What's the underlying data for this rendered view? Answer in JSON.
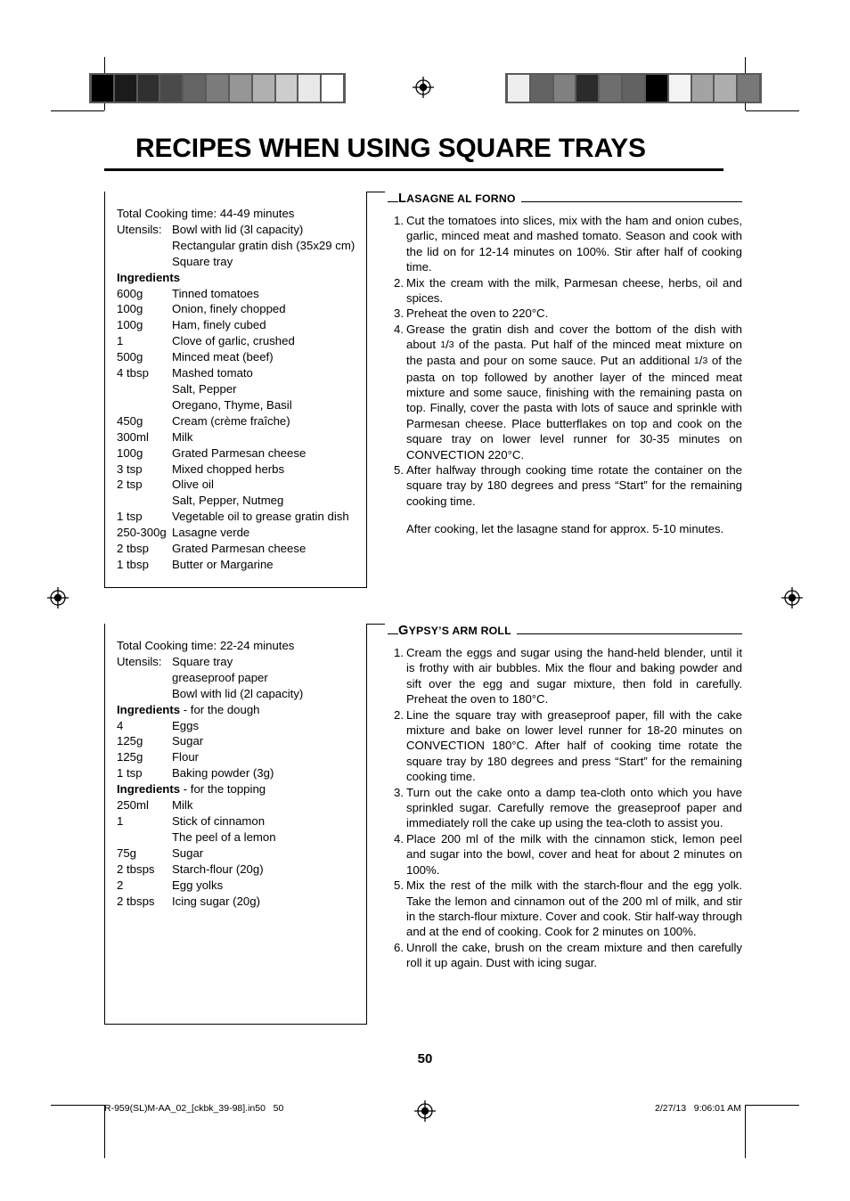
{
  "page": {
    "title": "RECIPES WHEN USING SQUARE TRAYS",
    "page_number": "50"
  },
  "printbar": {
    "left_wedge_name": "grayscale-step-wedge-left",
    "right_wedge_name": "grayscale-step-wedge-right",
    "left_patches": [
      "#000000",
      "#1b1b1b",
      "#303030",
      "#4a4a4a",
      "#646464",
      "#7b7b7b",
      "#969696",
      "#b0b0b0",
      "#cdcdcd",
      "#e8e8e8",
      "#ffffff"
    ],
    "right_patches": [
      "#eeeeee",
      "#636363",
      "#808080",
      "#2b2b2b",
      "#6e6e6e",
      "#626262",
      "#000000",
      "#f3f3f3",
      "#a3a3a3",
      "#aeaeae",
      "#787878"
    ]
  },
  "recipes": [
    {
      "heading_first": "L",
      "heading_rest": "ASAGNE AL FORNO",
      "cooking_time_label": "Total Cooking time:",
      "cooking_time_value": "44-49 minutes",
      "utensils_label": "Utensils:",
      "utensils": [
        "Bowl with lid (3l capacity)",
        "Rectangular gratin dish (35x29 cm)",
        "Square tray"
      ],
      "ingredients_label": "Ingredients",
      "ingredients_suffix": "",
      "ingredients": [
        {
          "qty": "600g",
          "name": "Tinned tomatoes"
        },
        {
          "qty": "100g",
          "name": "Onion, finely chopped"
        },
        {
          "qty": "100g",
          "name": "Ham, finely cubed"
        },
        {
          "qty": "1",
          "name": "Clove of garlic, crushed"
        },
        {
          "qty": "500g",
          "name": "Minced meat (beef)"
        },
        {
          "qty": "4 tbsp",
          "name": "Mashed tomato"
        },
        {
          "qty": "",
          "name": "Salt, Pepper"
        },
        {
          "qty": "",
          "name": "Oregano, Thyme, Basil"
        },
        {
          "qty": "450g",
          "name": "Cream (crème fraîche)"
        },
        {
          "qty": "300ml",
          "name": "Milk"
        },
        {
          "qty": "100g",
          "name": "Grated Parmesan cheese"
        },
        {
          "qty": "3 tsp",
          "name": "Mixed chopped herbs"
        },
        {
          "qty": "2 tsp",
          "name": "Olive oil"
        },
        {
          "qty": "",
          "name": "Salt, Pepper, Nutmeg"
        },
        {
          "qty": "1 tsp",
          "name": "Vegetable oil to grease gratin dish"
        },
        {
          "qty": "250-300g",
          "name": "Lasagne verde"
        },
        {
          "qty": "2 tbsp",
          "name": "Grated Parmesan cheese"
        },
        {
          "qty": "1 tbsp",
          "name": "Butter or Margarine"
        }
      ],
      "steps": [
        "Cut the tomatoes into slices, mix with the ham and onion cubes, garlic, minced meat and mashed tomato. Season and cook with the lid on for 12-14 minutes on 100%. Stir after half of cooking time.",
        "Mix the cream with the milk, Parmesan cheese, herbs, oil and spices.",
        "Preheat the oven to 220°C.",
        "Grease the gratin dish and cover the bottom of the dish with about <sup>1</sup>/<sub>3</sub> of the pasta. Put half of the minced meat mixture on the pasta and pour on some sauce. Put an additional <sup>1</sup>/<sub>3</sub> of the pasta on top followed by another layer of the minced meat mixture and some sauce, finishing with the remaining pasta on top. Finally, cover the pasta with lots of sauce and sprinkle with Parmesan cheese. Place butterflakes on top and cook on the square tray on lower level runner for 30-35 minutes on CONVECTION 220°C.",
        "After halfway through cooking time rotate the container on the square tray by 180 degrees and press “Start” for the remaining cooking time."
      ],
      "after_note": "After cooking, let the lasagne stand for approx. 5-10 minutes."
    },
    {
      "heading_first": "G",
      "heading_rest": "YPSY’S ARM ROLL",
      "cooking_time_label": "Total Cooking time:",
      "cooking_time_value": "22-24 minutes",
      "utensils_label": "Utensils:",
      "utensils": [
        "Square tray",
        "greaseproof paper",
        "Bowl with lid (2l capacity)"
      ],
      "ingredients_label": "Ingredients",
      "ingredients_suffix": " - for the dough",
      "ingredients": [
        {
          "qty": "4",
          "name": "Eggs"
        },
        {
          "qty": "125g",
          "name": "Sugar"
        },
        {
          "qty": "125g",
          "name": "Flour"
        },
        {
          "qty": "1 tsp",
          "name": "Baking powder (3g)"
        }
      ],
      "ingredients_label2": "Ingredients",
      "ingredients_suffix2": " - for the topping",
      "ingredients2": [
        {
          "qty": "250ml",
          "name": "Milk"
        },
        {
          "qty": "1",
          "name": "Stick of cinnamon"
        },
        {
          "qty": "",
          "name": "The peel of a lemon"
        },
        {
          "qty": "75g",
          "name": "Sugar"
        },
        {
          "qty": "2 tbsps",
          "name": "Starch-flour (20g)"
        },
        {
          "qty": "2",
          "name": "Egg yolks"
        },
        {
          "qty": "2 tbsps",
          "name": "Icing sugar (20g)"
        }
      ],
      "steps": [
        "Cream the eggs and sugar using the hand-held blender, until it is frothy with air bubbles. Mix the flour and baking powder and sift over the egg and sugar mixture, then fold in carefully. Preheat the oven to 180°C.",
        "Line the square tray with greaseproof paper, fill with the cake mixture and bake on lower level runner for 18-20 minutes on CONVECTION 180°C. After half of cooking time rotate the square tray by 180 degrees and press “Start” for the remaining cooking time.",
        "Turn out the cake onto a damp tea-cloth onto which you have sprinkled sugar. Carefully remove the greaseproof paper and immediately roll the cake up using the tea-cloth to assist you.",
        "Place 200 ml of the milk with the cinnamon stick, lemon peel and sugar into the bowl, cover and heat for about 2 minutes on 100%.",
        "Mix the rest of the milk with the starch-flour and the egg yolk. Take the lemon and cinnamon out of the 200 ml of milk, and stir in the starch-flour mixture. Cover and cook. Stir half-way through and at the end of cooking. Cook for 2 minutes on 100%.",
        "Unroll the cake, brush on the cream mixture and then carefully roll it up again. Dust with icing sugar."
      ],
      "after_note": ""
    }
  ],
  "footer": {
    "left_text": "R-959(SL)M-AA_02_[ckbk_39-98].in50   50",
    "right_text": "2/27/13   9:06:01 AM"
  }
}
